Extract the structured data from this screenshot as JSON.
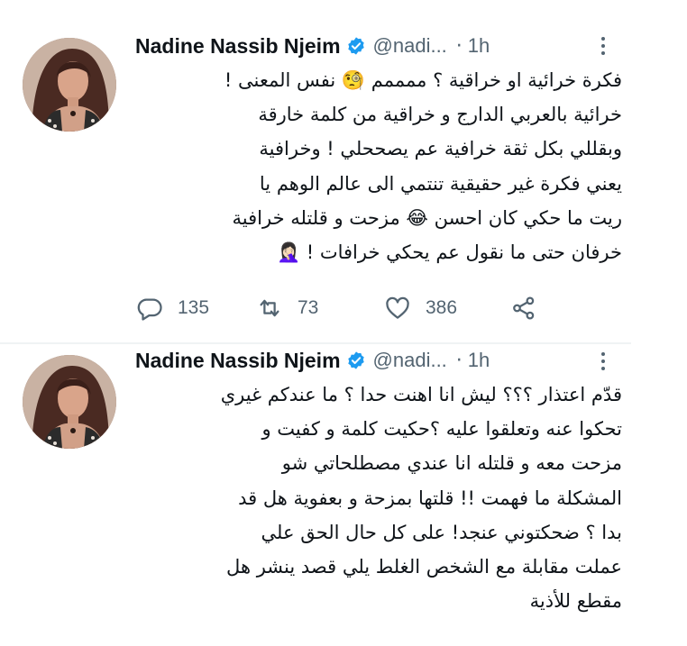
{
  "colors": {
    "text": "#0f1419",
    "secondary": "#536471",
    "verified": "#1d9bf0",
    "divider": "#eff3f4"
  },
  "tweets": [
    {
      "author": {
        "name": "Nadine Nassib Njeim",
        "handle": "@nadi...",
        "verified": true
      },
      "time": "1h",
      "lines": [
        "فكرة خرائية او خراقية ؟ ممممم 🧐 نفس المعنى !",
        "خرائية بالعربي الدارج و خراقية من كلمة خارقة",
        "وبقللي بكل ثقة خرافية عم يصححلي ! وخرافية",
        "يعني فكرة غير حقيقية تنتمي الى عالم الوهم يا",
        "ريت ما حكي كان احسن 😂 مزحت و قلتله خرافية",
        "خرفان حتى ما نقول عم يحكي خرافات ! 🤦🏻‍♀️"
      ],
      "actions": {
        "replies": "135",
        "retweets": "73",
        "likes": "386"
      }
    },
    {
      "author": {
        "name": "Nadine Nassib Njeim",
        "handle": "@nadi...",
        "verified": true
      },
      "time": "1h",
      "lines": [
        "قدّم اعتذار ؟؟؟ ليش انا اهنت حدا ؟ ما عندكم غيري",
        "تحكوا عنه وتعلقوا عليه ؟حكيت كلمة و كفيت و",
        "مزحت معه و قلتله انا عندي مصطلحاتي شو",
        "المشكلة ما فهمت !! قلتها بمزحة و بعفوية هل قد",
        "بدا ؟ ضحكتوني عنجد! على كل حال الحق علي",
        "عملت مقابلة مع الشخص الغلط يلي قصد ينشر هل",
        "مقطع للأذية"
      ]
    }
  ]
}
